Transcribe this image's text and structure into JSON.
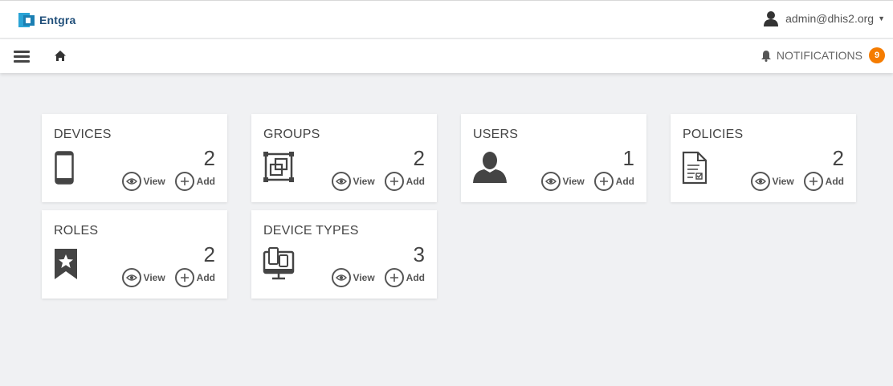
{
  "header": {
    "brand": "Entgra",
    "user": "admin@dhis2.org"
  },
  "navbar": {
    "notifications_label": "NOTIFICATIONS",
    "notifications_count": "9"
  },
  "cards": [
    {
      "title": "DEVICES",
      "count": "2",
      "icon": "mobile-icon",
      "view": "View",
      "add": "Add"
    },
    {
      "title": "GROUPS",
      "count": "2",
      "icon": "groups-icon",
      "view": "View",
      "add": "Add"
    },
    {
      "title": "USERS",
      "count": "1",
      "icon": "user-icon",
      "view": "View",
      "add": "Add"
    },
    {
      "title": "POLICIES",
      "count": "2",
      "icon": "policy-document-icon",
      "view": "View",
      "add": "Add"
    },
    {
      "title": "ROLES",
      "count": "2",
      "icon": "star-bookmark-icon",
      "view": "View",
      "add": "Add"
    },
    {
      "title": "DEVICE TYPES",
      "count": "3",
      "icon": "device-types-icon",
      "view": "View",
      "add": "Add"
    }
  ],
  "colors": {
    "accent": "#f57c00",
    "brand": "#1f4e79",
    "logo": "#2aa4d6"
  }
}
